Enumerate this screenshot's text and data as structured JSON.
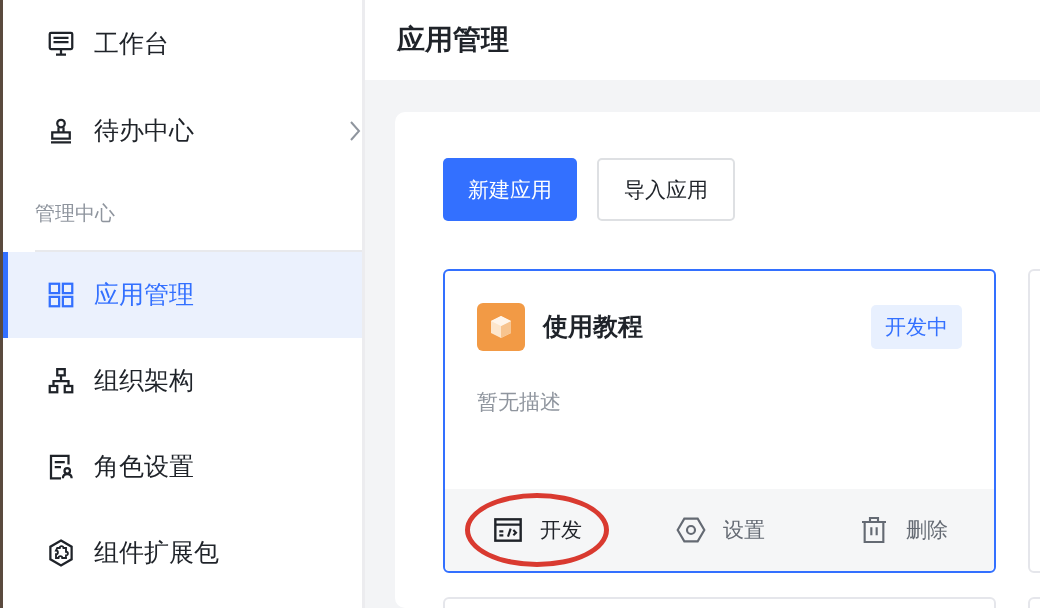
{
  "sidebar": {
    "items": [
      {
        "kind": "item",
        "label": "工作台",
        "selected": false,
        "has_submenu": false
      },
      {
        "kind": "item",
        "label": "待办中心",
        "selected": false,
        "has_submenu": true
      },
      {
        "kind": "section",
        "label": "管理中心"
      },
      {
        "kind": "item",
        "label": "应用管理",
        "selected": true,
        "has_submenu": false
      },
      {
        "kind": "item",
        "label": "组织架构",
        "selected": false,
        "has_submenu": false
      },
      {
        "kind": "item",
        "label": "角色设置",
        "selected": false,
        "has_submenu": false
      },
      {
        "kind": "item",
        "label": "组件扩展包",
        "selected": false,
        "has_submenu": false
      }
    ]
  },
  "header": {
    "title": "应用管理"
  },
  "toolbar": {
    "buttons": [
      {
        "label": "新建应用",
        "primary": true
      },
      {
        "label": "导入应用",
        "primary": false
      }
    ]
  },
  "app_card": {
    "name": "使用教程",
    "status": "开发中",
    "description": "暂无描述",
    "selected": true,
    "actions": [
      {
        "label": "开发",
        "circled": true
      },
      {
        "label": "设置",
        "circled": false
      },
      {
        "label": "删除",
        "circled": false
      }
    ]
  }
}
